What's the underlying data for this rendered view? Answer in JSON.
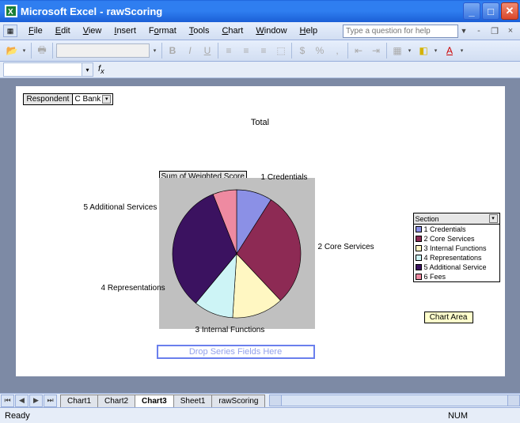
{
  "window": {
    "app": "Microsoft Excel",
    "doc": "rawScoring"
  },
  "menu": {
    "file": "File",
    "edit": "Edit",
    "view": "View",
    "insert": "Insert",
    "format": "Format",
    "tools": "Tools",
    "chart": "Chart",
    "window": "Window",
    "help": "Help"
  },
  "help_placeholder": "Type a question for help",
  "pivot_filter": {
    "label": "Respondent",
    "value": "C Bank"
  },
  "chart_title": "Total",
  "pivot_field": "Sum of Weighted Score",
  "labels": {
    "l1": "1 Credentials",
    "l2": "2 Core Services",
    "l3": "3 Internal Functions",
    "l4": "4 Representations",
    "l5": "5 Additional Services",
    "l6": "6 Fees"
  },
  "legend": {
    "header": "Section",
    "items": [
      {
        "name": "1 Credentials",
        "color": "#8b90e6"
      },
      {
        "name": "2 Core Services",
        "color": "#8d2a54"
      },
      {
        "name": "3 Internal Functions",
        "color": "#fff7c2"
      },
      {
        "name": "4 Representations",
        "color": "#cdf4f6"
      },
      {
        "name": "5 Additional Service",
        "color": "#3b1260"
      },
      {
        "name": "6 Fees",
        "color": "#ee8aa1"
      }
    ]
  },
  "chart_area_label": "Chart Area",
  "drop_series": "Drop Series Fields Here",
  "tabs": {
    "t1": "Chart1",
    "t2": "Chart2",
    "t3": "Chart3",
    "t4": "Sheet1",
    "t5": "rawScoring"
  },
  "status": {
    "ready": "Ready",
    "num": "NUM"
  },
  "chart_data": {
    "type": "pie",
    "title": "Total",
    "value_field": "Sum of Weighted Score",
    "filter": {
      "field": "Respondent",
      "value": "C Bank"
    },
    "section_field": "Section",
    "series": [
      {
        "name": "Sum of Weighted Score",
        "slices": [
          {
            "category": "1 Credentials",
            "share": 0.09,
            "color": "#8b90e6"
          },
          {
            "category": "2 Core Services",
            "share": 0.29,
            "color": "#8d2a54"
          },
          {
            "category": "3 Internal Functions",
            "share": 0.13,
            "color": "#fff7c2"
          },
          {
            "category": "4 Representations",
            "share": 0.1,
            "color": "#cdf4f6"
          },
          {
            "category": "5 Additional Services",
            "share": 0.33,
            "color": "#3b1260"
          },
          {
            "category": "6 Fees",
            "share": 0.06,
            "color": "#ee8aa1"
          }
        ]
      }
    ]
  }
}
